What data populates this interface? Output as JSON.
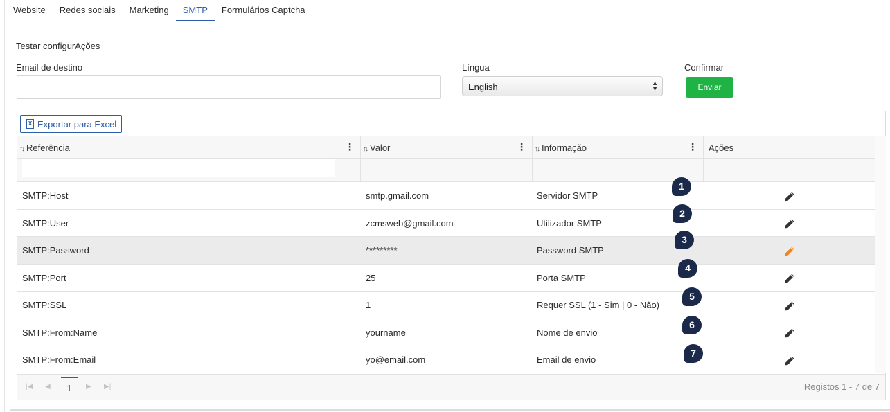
{
  "tabs": [
    {
      "label": "Website"
    },
    {
      "label": "Redes sociais"
    },
    {
      "label": "Marketing"
    },
    {
      "label": "SMTP",
      "active": true
    },
    {
      "label": "Formulários Captcha"
    }
  ],
  "test_section": {
    "title": "Testar configurAções",
    "email_label": "Email de destino",
    "email_value": "",
    "language_label": "Língua",
    "language_selected": "English",
    "confirm_label": "Confirmar",
    "send_button": "Enviar"
  },
  "grid": {
    "export_button": "Exportar para Excel",
    "columns": [
      {
        "label": "Referência"
      },
      {
        "label": "Valor"
      },
      {
        "label": "Informação"
      },
      {
        "label": "Ações"
      }
    ],
    "rows": [
      {
        "ref": "SMTP:Host",
        "value": "smtp.gmail.com",
        "info": "Servidor SMTP"
      },
      {
        "ref": "SMTP:User",
        "value": "zcmsweb@gmail.com",
        "info": "Utilizador SMTP"
      },
      {
        "ref": "SMTP:Password",
        "value": "*********",
        "info": "Password SMTP",
        "highlighted": true
      },
      {
        "ref": "SMTP:Port",
        "value": "25",
        "info": "Porta SMTP"
      },
      {
        "ref": "SMTP:SSL",
        "value": "1",
        "info": "Requer SSL (1 - Sim | 0 - Não)"
      },
      {
        "ref": "SMTP:From:Name",
        "value": "yourname",
        "info": "Nome de envio"
      },
      {
        "ref": "SMTP:From:Email",
        "value": "yo@email.com",
        "info": "Email de envio"
      }
    ],
    "pager": {
      "current_page": "1",
      "summary": "Registos 1 - 7 de 7"
    }
  },
  "annotation_badges": [
    "1",
    "2",
    "3",
    "4",
    "5",
    "6",
    "7"
  ],
  "colors": {
    "accent": "#2f5ea8",
    "send_button": "#1fb244",
    "badge": "#1b2a4a",
    "edit_icon": "#333333",
    "edit_icon_active": "#f0841e"
  }
}
